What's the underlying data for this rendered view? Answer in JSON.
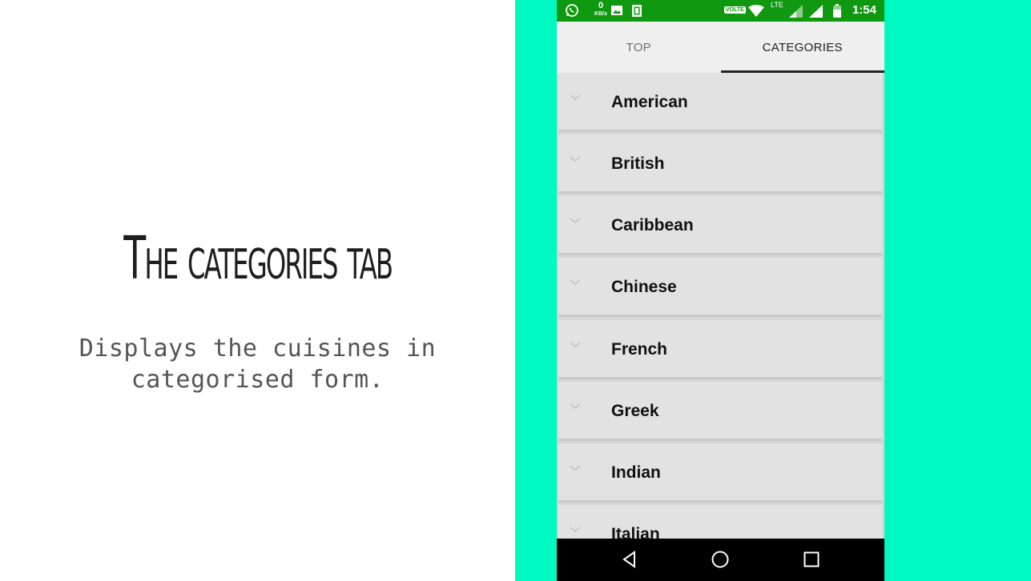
{
  "slide": {
    "title": "The categories tab",
    "subtitle_line1": "Displays the cuisines in",
    "subtitle_line2": "categorised form."
  },
  "status_bar": {
    "time": "1:54",
    "net_speed": "0",
    "net_unit": "KB/s",
    "volte": "VOLTE",
    "lte": "LTE",
    "bg_color": "#109810"
  },
  "tabs": [
    {
      "label": "TOP",
      "active": false
    },
    {
      "label": "CATEGORIES",
      "active": true
    }
  ],
  "categories": [
    {
      "label": "American"
    },
    {
      "label": "British"
    },
    {
      "label": "Caribbean"
    },
    {
      "label": "Chinese"
    },
    {
      "label": "French"
    },
    {
      "label": "Greek"
    },
    {
      "label": "Indian"
    },
    {
      "label": "Italian"
    }
  ],
  "colors": {
    "panel_bg": "#00f9c3",
    "row_bg": "#e2e2e2"
  }
}
